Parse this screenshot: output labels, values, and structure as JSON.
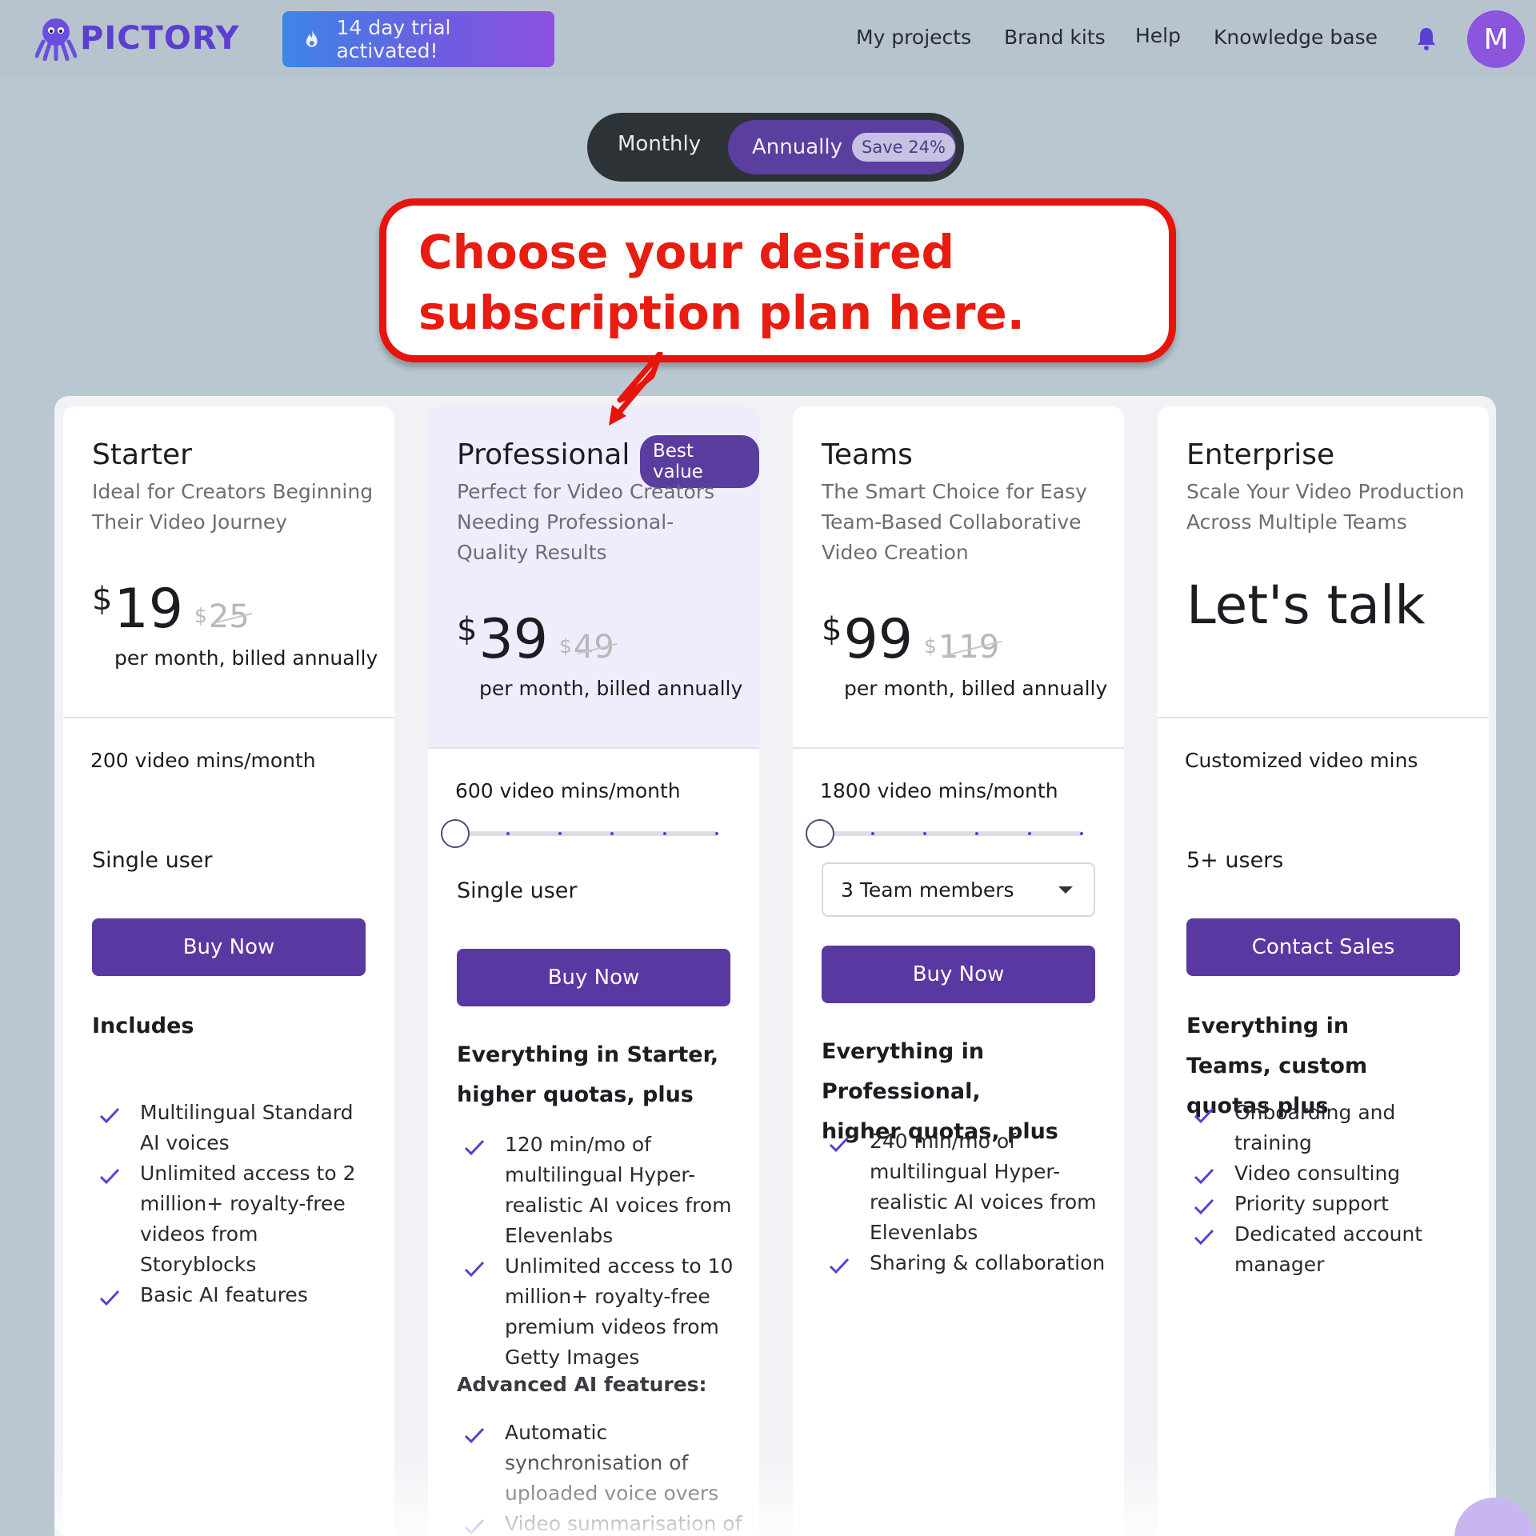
{
  "header": {
    "logo_text": "PICTORY",
    "trial_text": "14 day trial activated!",
    "nav": [
      "My projects",
      "Brand kits",
      "Help",
      "Knowledge base"
    ],
    "avatar_initial": "M"
  },
  "billing_toggle": {
    "monthly_label": "Monthly",
    "annual_label": "Annually",
    "save_badge": "Save 24%",
    "selected": "Annually"
  },
  "callout": {
    "text": "Choose your desired subscription plan here."
  },
  "plans": [
    {
      "name": "Starter",
      "description": "Ideal for Creators Beginning Their Video Journey",
      "currency": "$",
      "price": "19",
      "old_price": "25",
      "billing": "per month, billed annually",
      "mins": "200 video mins/month",
      "users": "Single user",
      "cta": "Buy Now",
      "includes_heading": "Includes",
      "features": [
        "Multilingual Standard AI voices",
        "Unlimited access to 2 million+ royalty-free videos from Storyblocks",
        "Basic AI features"
      ]
    },
    {
      "name": "Professional",
      "badge": "Best value",
      "description": "Perfect for Video Creators Needing Professional-Quality Results",
      "currency": "$",
      "price": "39",
      "old_price": "49",
      "billing": "per month, billed annually",
      "mins": "600 video mins/month",
      "users": "Single user",
      "cta": "Buy Now",
      "includes_heading": "Everything in Starter, higher quotas, plus",
      "features": [
        "120 min/mo of multilingual Hyper-realistic AI voices from Elevenlabs",
        "Unlimited access to 10 million+ royalty-free premium videos from Getty Images"
      ],
      "advanced_heading": "Advanced AI features:",
      "advanced_features": [
        "Automatic synchronisation of uploaded voice overs",
        "Video summarisation of"
      ]
    },
    {
      "name": "Teams",
      "description": "The Smart Choice for Easy Team-Based Collaborative Video Creation",
      "currency": "$",
      "price": "99",
      "old_price": "119",
      "billing": "per month, billed annually",
      "mins": "1800 video mins/month",
      "team_select": "3 Team members",
      "cta": "Buy Now",
      "includes_heading": "Everything in Professional, higher quotas, plus",
      "features": [
        "240 min/mo of multilingual Hyper-realistic AI voices from Elevenlabs",
        "Sharing & collaboration"
      ]
    },
    {
      "name": "Enterprise",
      "description": "Scale Your Video Production Across Multiple Teams",
      "price_text": "Let's talk",
      "mins": "Customized video mins",
      "users": "5+ users",
      "cta": "Contact Sales",
      "includes_heading": "Everything in Teams, custom quotas plus",
      "features": [
        "Onboarding and training",
        "Video consulting",
        "Priority support",
        "Dedicated account manager"
      ]
    }
  ],
  "colors": {
    "brand": "#5b3fd0",
    "button": "#5a38a1",
    "callout_red": "#e8140c",
    "background": "#b9c7d1"
  }
}
